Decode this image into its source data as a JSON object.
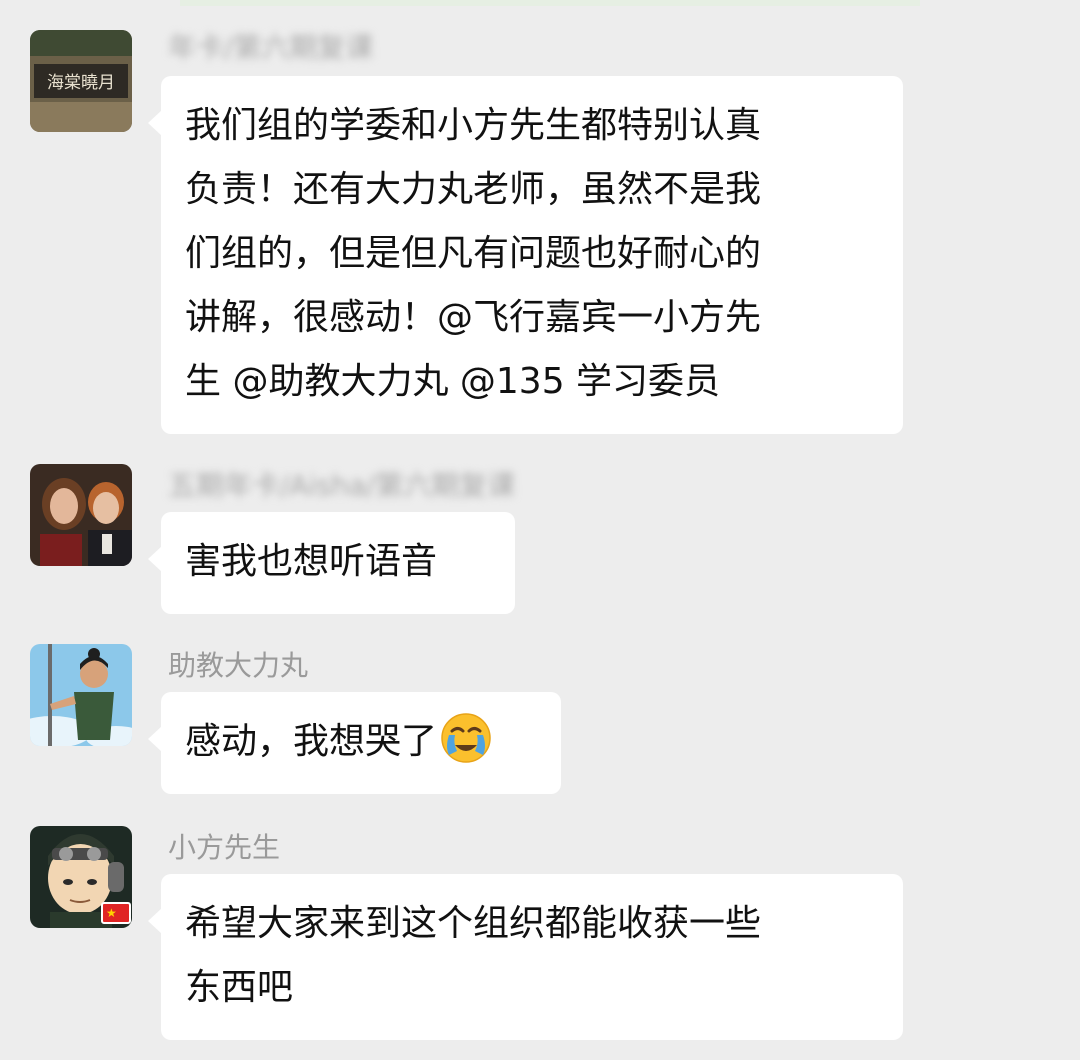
{
  "messages": [
    {
      "sender": "年卡/第六期复课",
      "text": "我们组的学委和小方先生都特别认真\n负责！还有大力丸老师，虽然不是我\n们组的，但是但凡有问题也好耐心的\n讲解，很感动！@飞行嘉宾一小方先\n生 @助教大力丸 @135 学习委员",
      "avatar_text": "海棠曉月"
    },
    {
      "sender": "五期年卡/Aisha/第六期复课",
      "text": "害我也想听语音"
    },
    {
      "sender": "助教大力丸",
      "text": "感动，我想哭了",
      "emoji": "loudly-crying-face"
    },
    {
      "sender": "小方先生",
      "text": "希望大家来到这个组织都能收获一些\n东西吧",
      "badge": "★"
    }
  ]
}
